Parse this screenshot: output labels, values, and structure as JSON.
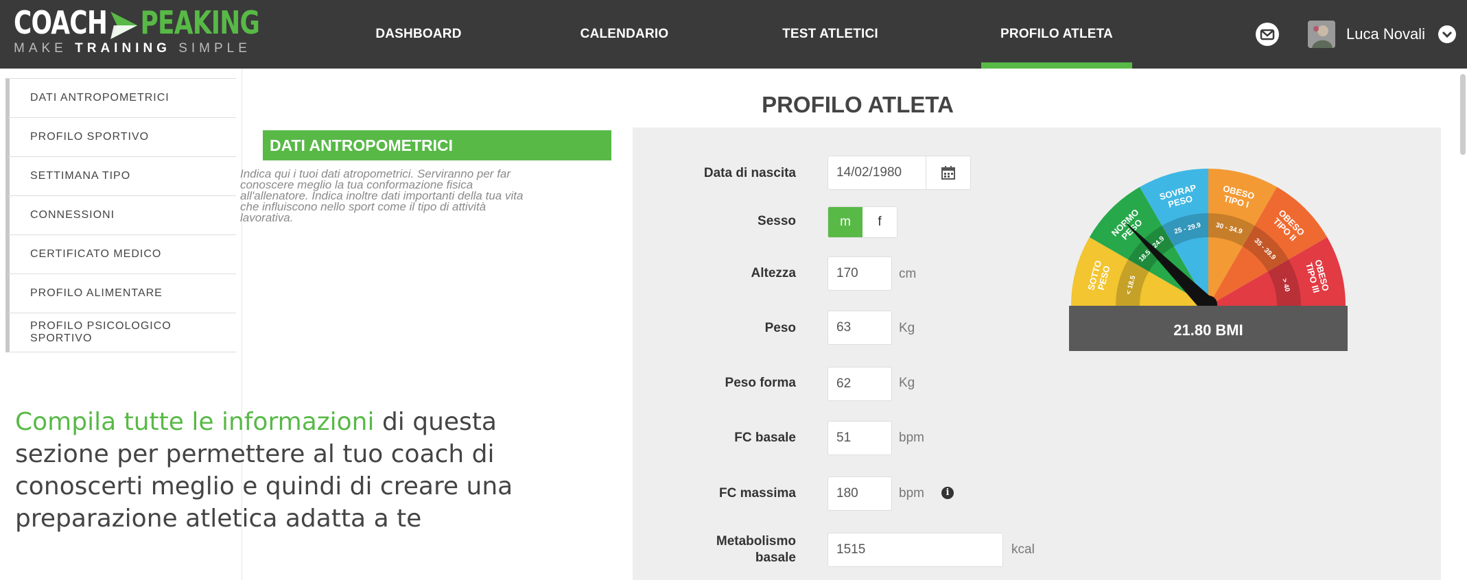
{
  "brand": {
    "logo_left": "COACH",
    "logo_right": "PEAKING",
    "tagline_pre": "MAKE ",
    "tagline_bold": "TRAINING",
    "tagline_post": " SIMPLE",
    "accent": "#58b947",
    "header_bg": "#3a3a3a"
  },
  "nav": {
    "items": [
      {
        "label": "DASHBOARD",
        "active": false
      },
      {
        "label": "CALENDARIO",
        "active": false
      },
      {
        "label": "TEST ATLETICI",
        "active": false
      },
      {
        "label": "PROFILO ATLETA",
        "active": true
      }
    ]
  },
  "header": {
    "mail_icon": "envelope-icon",
    "user_name": "Luca Novali",
    "user_menu_icon": "chevron-down-icon"
  },
  "sidebar": {
    "items": [
      {
        "label": "DATI ANTROPOMETRICI"
      },
      {
        "label": "PROFILO SPORTIVO"
      },
      {
        "label": "SETTIMANA TIPO"
      },
      {
        "label": "CONNESSIONI"
      },
      {
        "label": "CERTIFICATO MEDICO"
      },
      {
        "label": "PROFILO ALIMENTARE"
      },
      {
        "label": "PROFILO PSICOLOGICO SPORTIVO"
      }
    ]
  },
  "page": {
    "title": "PROFILO ATLETA"
  },
  "section": {
    "title": "DATI ANTROPOMETRICI",
    "desc_lines": [
      "Indica qui i tuoi dati atropometrici. Serviranno per far",
      "conoscere meglio la tua conformazione fisica",
      "all'allenatore. Indica inoltre dati importanti della tua vita",
      "che influiscono nello sport come il tipo di attività",
      "lavorativa."
    ]
  },
  "promo": {
    "highlight": "Compila tutte le informazioni",
    "rest1": " di questa",
    "line2": "sezione per permettere al tuo coach di",
    "line3": "conoscerti meglio e quindi di creare una",
    "line4": "preparazione atletica adatta a te"
  },
  "form": {
    "birth": {
      "label": "Data di nascita",
      "value": "14/02/1980",
      "icon": "calendar-icon"
    },
    "sex": {
      "label": "Sesso",
      "options": [
        "m",
        "f"
      ],
      "selected": "m"
    },
    "height": {
      "label": "Altezza",
      "value": "170",
      "unit": "cm"
    },
    "weight": {
      "label": "Peso",
      "value": "63",
      "unit": "Kg"
    },
    "ideal_weight": {
      "label": "Peso forma",
      "value": "62",
      "unit": "Kg"
    },
    "hr_rest": {
      "label": "FC basale",
      "value": "51",
      "unit": "bpm"
    },
    "hr_max": {
      "label": "FC massima",
      "value": "180",
      "unit": "bpm",
      "info_icon": "info-icon"
    },
    "bmr": {
      "label_line1": "Metabolismo",
      "label_line2": "basale",
      "value": "1515",
      "unit": "kcal"
    }
  },
  "bmi_gauge": {
    "value_label": "21.80 BMI",
    "value": 21.8,
    "segments": [
      {
        "name_lines": [
          "SOTTO",
          "PESO"
        ],
        "range": "< 18.5",
        "color": "#f2c531"
      },
      {
        "name_lines": [
          "NORMO",
          "PESO"
        ],
        "range": "18.5 - 24.9",
        "color": "#27a84a"
      },
      {
        "name_lines": [
          "SOVRAP",
          "PESO"
        ],
        "range": "25 - 29.9",
        "color": "#3fb7e4"
      },
      {
        "name_lines": [
          "OBESO",
          "TIPO I"
        ],
        "range": "30 - 34.9",
        "color": "#f39a34"
      },
      {
        "name_lines": [
          "OBESO",
          "TIPO II"
        ],
        "range": "35 - 39.9",
        "color": "#ef6a30"
      },
      {
        "name_lines": [
          "OBESO",
          "TIPO III"
        ],
        "range": "> 40",
        "color": "#e23b44"
      }
    ]
  }
}
